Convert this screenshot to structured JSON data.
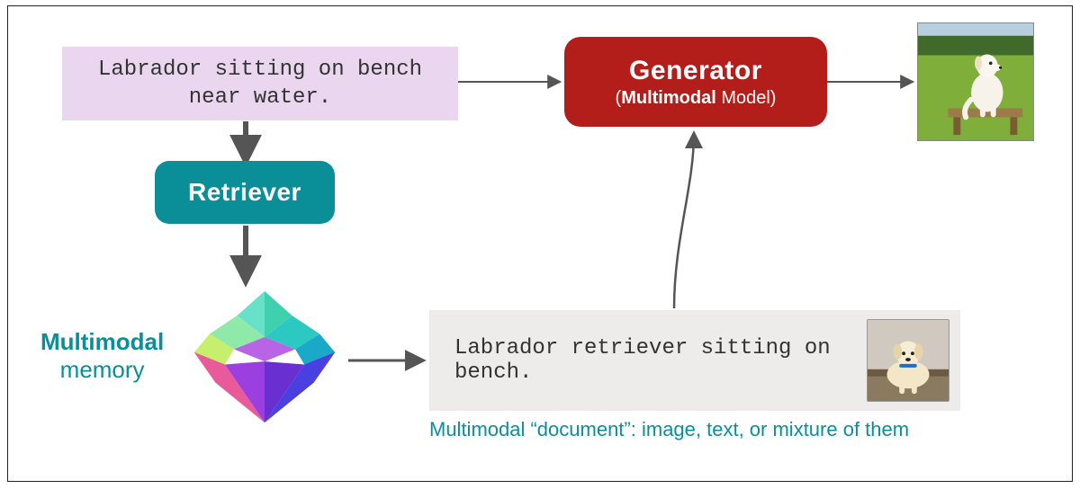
{
  "diagram": {
    "type": "retrieval-augmented-generation-multimodal",
    "input_prompt": "Labrador sitting on bench near water.",
    "retriever": {
      "label": "Retriever"
    },
    "memory": {
      "label_bold": "Multimodal",
      "label_rest": "memory"
    },
    "retrieved_document": {
      "text": "Labrador retriever sitting on bench.",
      "image_alt": "Labrador on wooden bench"
    },
    "document_caption": "Multimodal “document”: image, text, or mixture of them",
    "generator": {
      "title": "Generator",
      "subtitle_bold": "Multimodal",
      "subtitle_rest": "Model"
    },
    "output_image_alt": "Generated image of a dog sitting on a bench near water",
    "colors": {
      "teal": "#0a8f98",
      "red": "#b31e1a",
      "lilac": "#ead7ef",
      "grey": "#eeecea"
    }
  }
}
